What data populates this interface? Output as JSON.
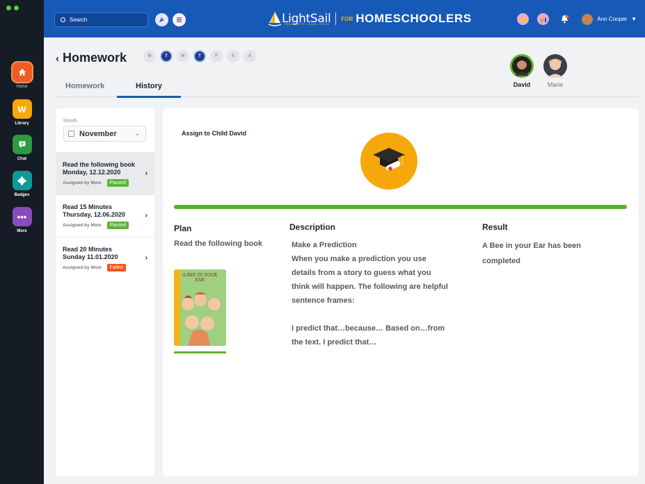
{
  "rail": {
    "items": [
      {
        "label": "Home",
        "icon": "home-icon",
        "color": "#ef5d26"
      },
      {
        "label": "Library",
        "icon": "library-icon",
        "color": "#f6a80b"
      },
      {
        "label": "Chat",
        "icon": "chat-icon",
        "color": "#2e9a42"
      },
      {
        "label": "Badges",
        "icon": "badge-icon",
        "color": "#0f9a94"
      },
      {
        "label": "More",
        "icon": "more-icon",
        "color": "#8a4bbd"
      }
    ]
  },
  "topbar": {
    "search_placeholder": "Search",
    "logo_brand": "LightSail",
    "logo_tagline": "READ. WRITE. LEARN. GROW.",
    "logo_for": "FOR",
    "logo_product": "HOMESCHOOLERS",
    "user_name": "Ann Cooper"
  },
  "header": {
    "title": "Homework",
    "days": [
      "M",
      "T",
      "W",
      "T",
      "F",
      "S",
      "S"
    ],
    "tabs": [
      "Homework",
      "History"
    ],
    "children": [
      "David",
      "Marie"
    ]
  },
  "filter": {
    "month_label": "Month",
    "month_value": "November"
  },
  "history": [
    {
      "title": "Read the following book",
      "date": "Monday, 12.12.2020",
      "by": "Assigned by Mom",
      "status": "Passed"
    },
    {
      "title": "Read 15 Minutes",
      "date": "Thursday, 12.06.2020",
      "by": "Assigned by Mom",
      "status": "Passed"
    },
    {
      "title": "Read 20 Minutes",
      "date": "Sunday 11.01.2020",
      "by": "Assigned by Mom",
      "status": "Failed"
    }
  ],
  "detail": {
    "assign": "Assign to Child David",
    "plan_h": "Plan",
    "plan_text": "Read the following book",
    "desc_h": "Description",
    "desc_1": "Make a Prediction",
    "desc_2": "When you make a prediction you use details from a story to guess what you think will happen. The following are helpful sentence frames:",
    "desc_3": "I predict that…because… Based on…from the text. I predict that…",
    "result_h": "Result",
    "result_text": "A Bee in your Ear has been completed",
    "book_cover_title": "A BEE IN YOUR EAR"
  },
  "colors": {
    "accent": "#1759b7",
    "pass": "#5eb23a",
    "fail": "#f1541b",
    "progress": "#5eb023"
  }
}
